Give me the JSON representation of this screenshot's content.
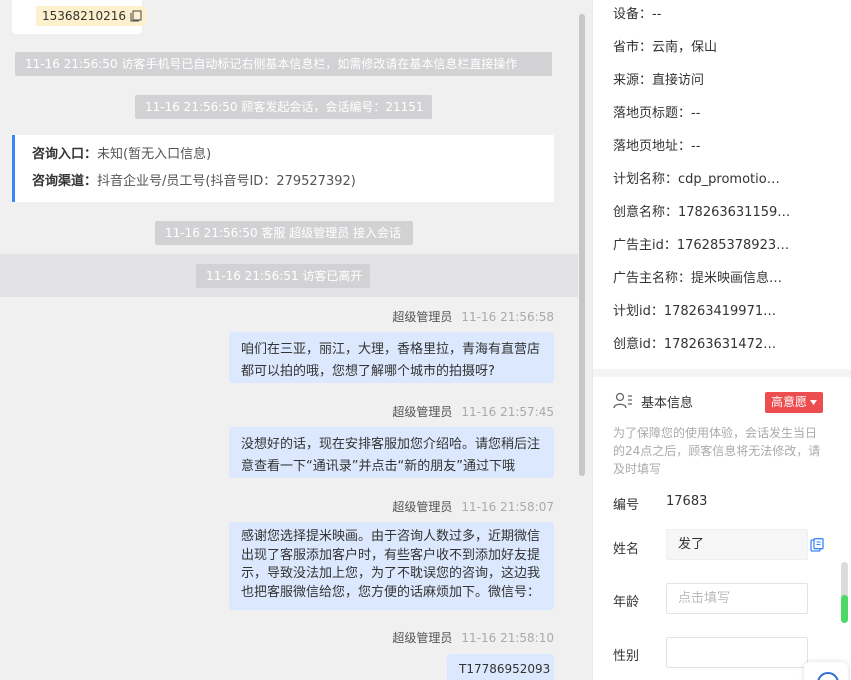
{
  "chat": {
    "phone": "15368210216",
    "sys_msgs": [
      "11-16 21:56:50 访客手机号已自动标记右侧基本信息栏，如需修改请在基本信息栏直接操作",
      "11-16 21:56:50 顾客发起会话，会话编号：21151",
      "11-16 21:56:50 客服 超级管理员 接入会话",
      "11-16 21:56:51 访客已离开"
    ],
    "entry": {
      "label1": "咨询入口：",
      "value1": "未知(暂无入口信息)",
      "label2": "咨询渠道：",
      "value2": "抖音企业号/员工号(抖音号ID：279527392)"
    },
    "messages": [
      {
        "sender": "超级管理员",
        "time": "11-16 21:56:58",
        "line1": "咱们在三亚，丽江，大理，香格里拉，青海有直营店",
        "line2": "都可以拍的哦，您想了解哪个城市的拍摄呀?"
      },
      {
        "sender": "超级管理员",
        "time": "11-16 21:57:45",
        "line1": "没想好的话，现在安排客服加您介绍哈。请您稍后注",
        "line2": "意查看一下“通讯录”并点击“新的朋友”通过下哦"
      },
      {
        "sender": "超级管理员",
        "time": "11-16 21:58:07",
        "line1": "感谢您选择提米映画。由于咨询人数过多，近期微信",
        "line2": "出现了客服添加客户时，有些客户收不到添加好友提",
        "line3": "示，导致没法加上您，为了不耽误您的咨询，这边我",
        "line4": "也把客服微信给您，您方便的话麻烦加下。微信号："
      },
      {
        "sender": "超级管理员",
        "time": "11-16 21:58:10",
        "line1": "T17786952093"
      }
    ]
  },
  "side": {
    "meta": [
      "设备：--",
      "省市：云南，保山",
      "来源：直接访问",
      "落地页标题：--",
      "落地页地址：--",
      "计划名称：cdp_promotio…",
      "创意名称：178263631159…",
      "广告主id：176285378923…",
      "广告主名称：提米映画信息…",
      "计划id：178263419971…",
      "创意id：178263631472…"
    ],
    "basic_title": "基本信息",
    "intent": "高意愿",
    "note": "为了保障您的使用体验，会话发生当日的24点之后，顾客信息将无法修改，请及时填写",
    "fields": {
      "id_label": "编号",
      "id_value": "17683",
      "name_label": "姓名",
      "name_value": "发了",
      "age_label": "年龄",
      "age_placeholder": "点击填写",
      "gender_label": "性别"
    }
  }
}
